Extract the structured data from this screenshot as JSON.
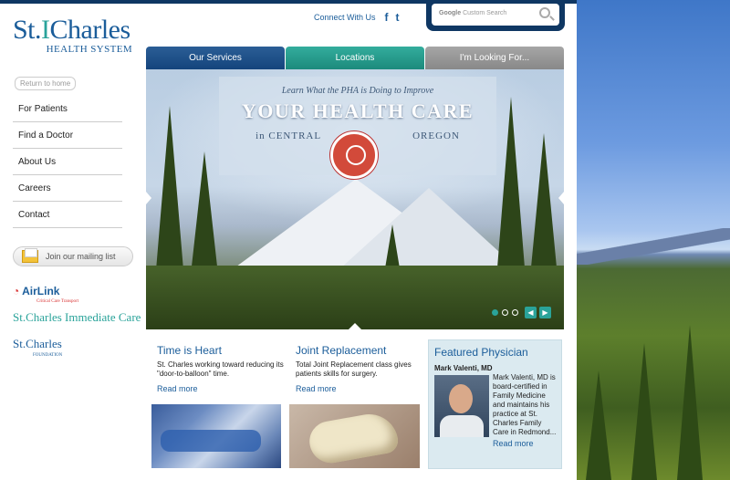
{
  "logo": {
    "brand_prefix": "St.",
    "brand_i": "I",
    "brand_suffix": "Charles",
    "sub": "HEALTH SYSTEM"
  },
  "return_home": "Return to home",
  "nav": {
    "items": [
      {
        "label": "For Patients"
      },
      {
        "label": "Find a Doctor"
      },
      {
        "label": "About Us"
      },
      {
        "label": "Careers"
      },
      {
        "label": "Contact"
      }
    ]
  },
  "mailing": {
    "label": "Join our mailing list"
  },
  "partners": {
    "airlink": {
      "name": "AirLink",
      "tag": "Critical Care Transport"
    },
    "immediate_care": {
      "name": "St.Charles Immediate Care"
    },
    "foundation": {
      "name": "St.Charles",
      "tag": "FOUNDATION"
    }
  },
  "header": {
    "connect": "Connect With Us",
    "facebook": "f",
    "twitter": "t",
    "search_placeholder_brand": "Google",
    "search_placeholder": "Custom Search"
  },
  "tabs": [
    {
      "label": "Our Services"
    },
    {
      "label": "Locations"
    },
    {
      "label": "I'm Looking For..."
    }
  ],
  "hero": {
    "line1": "Learn What the PHA is Doing to Improve",
    "line2": "YOUR HEALTH CARE",
    "line3_left": "in CENTRAL",
    "line3_right": "OREGON",
    "prev": "◀",
    "next": "▶"
  },
  "cards": [
    {
      "title": "Time is Heart",
      "text": "St. Charles working toward reducing its \"door-to-balloon\" time.",
      "more": "Read more"
    },
    {
      "title": "Joint Replacement",
      "text": "Total Joint Replacement class gives patients skills for surgery.",
      "more": "Read more"
    }
  ],
  "featured": {
    "title": "Featured Physician",
    "name": "Mark Valenti, MD",
    "bio": "Mark Valenti, MD is board-certified in Family Medicine and maintains his practice at St. Charles Family Care in Redmond...",
    "more": "Read more"
  },
  "colors": {
    "brand_blue": "#1b5d9a",
    "teal": "#2aa39a",
    "navy": "#0f3763"
  }
}
